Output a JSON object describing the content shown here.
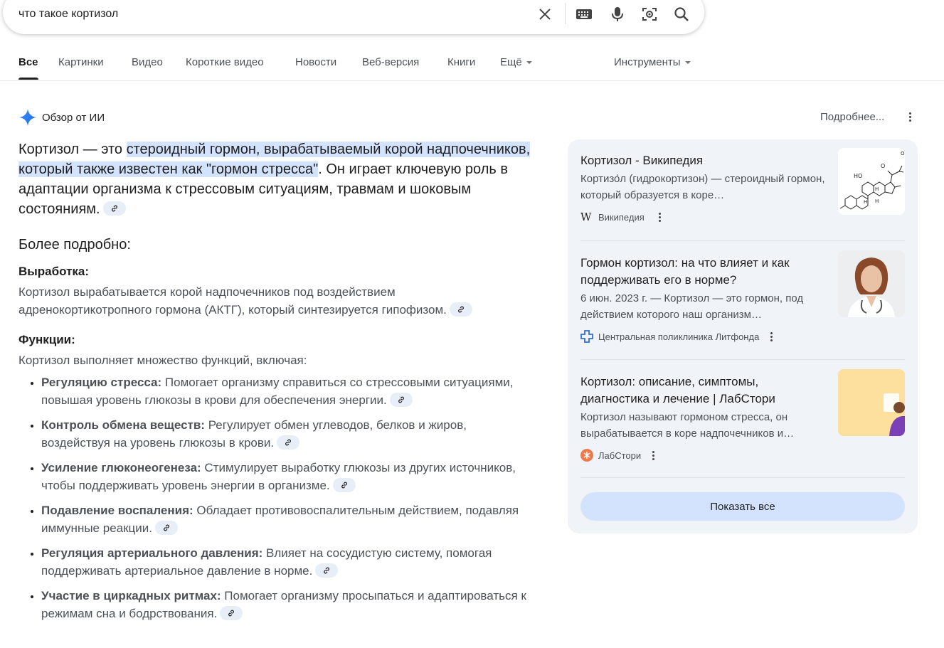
{
  "search": {
    "query": "что такое кортизол"
  },
  "tabs": [
    {
      "label": "Все"
    },
    {
      "label": "Картинки"
    },
    {
      "label": "Видео"
    },
    {
      "label": "Короткие видео"
    },
    {
      "label": "Новости"
    },
    {
      "label": "Веб-версия"
    },
    {
      "label": "Книги"
    },
    {
      "label": "Ещё"
    }
  ],
  "tools_label": "Инструменты",
  "ai_overview": {
    "title": "Обзор от ИИ",
    "more_label": "Подробнее...",
    "lead_start": "Кортизол — это ",
    "lead_highlight": "стероидный гормон, вырабатываемый корой надпочечников, который также известен как \"гормон стресса\"",
    "lead_end": ". Он играет ключевую роль в адаптации организма к стрессовым ситуациям, травмам и шоковым состояниям.",
    "more_heading": "Более подробно:",
    "production_heading": "Выработка:",
    "production_text": "Кортизол вырабатывается корой надпочечников под воздействием адренокортикотропного гормона (АКТГ), который синтезируется гипофизом.",
    "functions_heading": "Функции:",
    "functions_intro": "Кортизол выполняет множество функций, включая:",
    "functions": [
      {
        "term": "Регуляцию стресса:",
        "text": " Помогает организму справиться со стрессовыми ситуациями, повышая уровень глюкозы в крови для обеспечения энергии."
      },
      {
        "term": "Контроль обмена веществ:",
        "text": " Регулирует обмен углеводов, белков и жиров, воздействуя на уровень глюкозы в крови."
      },
      {
        "term": "Усиление глюконеогенеза:",
        "text": " Стимулирует выработку глюкозы из других источников, чтобы поддерживать уровень энергии в организме."
      },
      {
        "term": "Подавление воспаления:",
        "text": " Обладает противовоспалительным действием, подавляя иммунные реакции."
      },
      {
        "term": "Регуляция артериального давления:",
        "text": " Влияет на сосудистую систему, помогая поддерживать артериальное давление в норме."
      },
      {
        "term": "Участие в циркадных ритмах:",
        "text": " Помогает организму просыпаться и адаптироваться к режимам сна и бодрствования."
      }
    ]
  },
  "sources": [
    {
      "title": "Кортизол - Википедия",
      "snippet": "Кортизо́л (гидрокортизон) — стероидный гормон, который образуется в коре…",
      "source": "Википедия",
      "icon": "wikipedia-icon"
    },
    {
      "title": "Гормон кортизол: на что влияет и как поддерживать его в норме?",
      "snippet": "6 июн. 2023 г. — Кортизол — это гормон, под действием которого наш организм…",
      "source": "Центральная поликлиника Литфонда",
      "icon": "clinic-icon"
    },
    {
      "title": "Кортизол: описание, симптомы, диагностика и лечение | ЛабСтори",
      "snippet": "Кортизол называют гормоном стресса, он вырабатывается в коре надпочечников и…",
      "source": "ЛабСтори",
      "icon": "labstory-icon"
    }
  ],
  "show_all_label": "Показать все",
  "colors": {
    "highlight": "#d3e3fd",
    "panel_bg": "#f0f4f9",
    "ai_spark": "#4285f4"
  }
}
